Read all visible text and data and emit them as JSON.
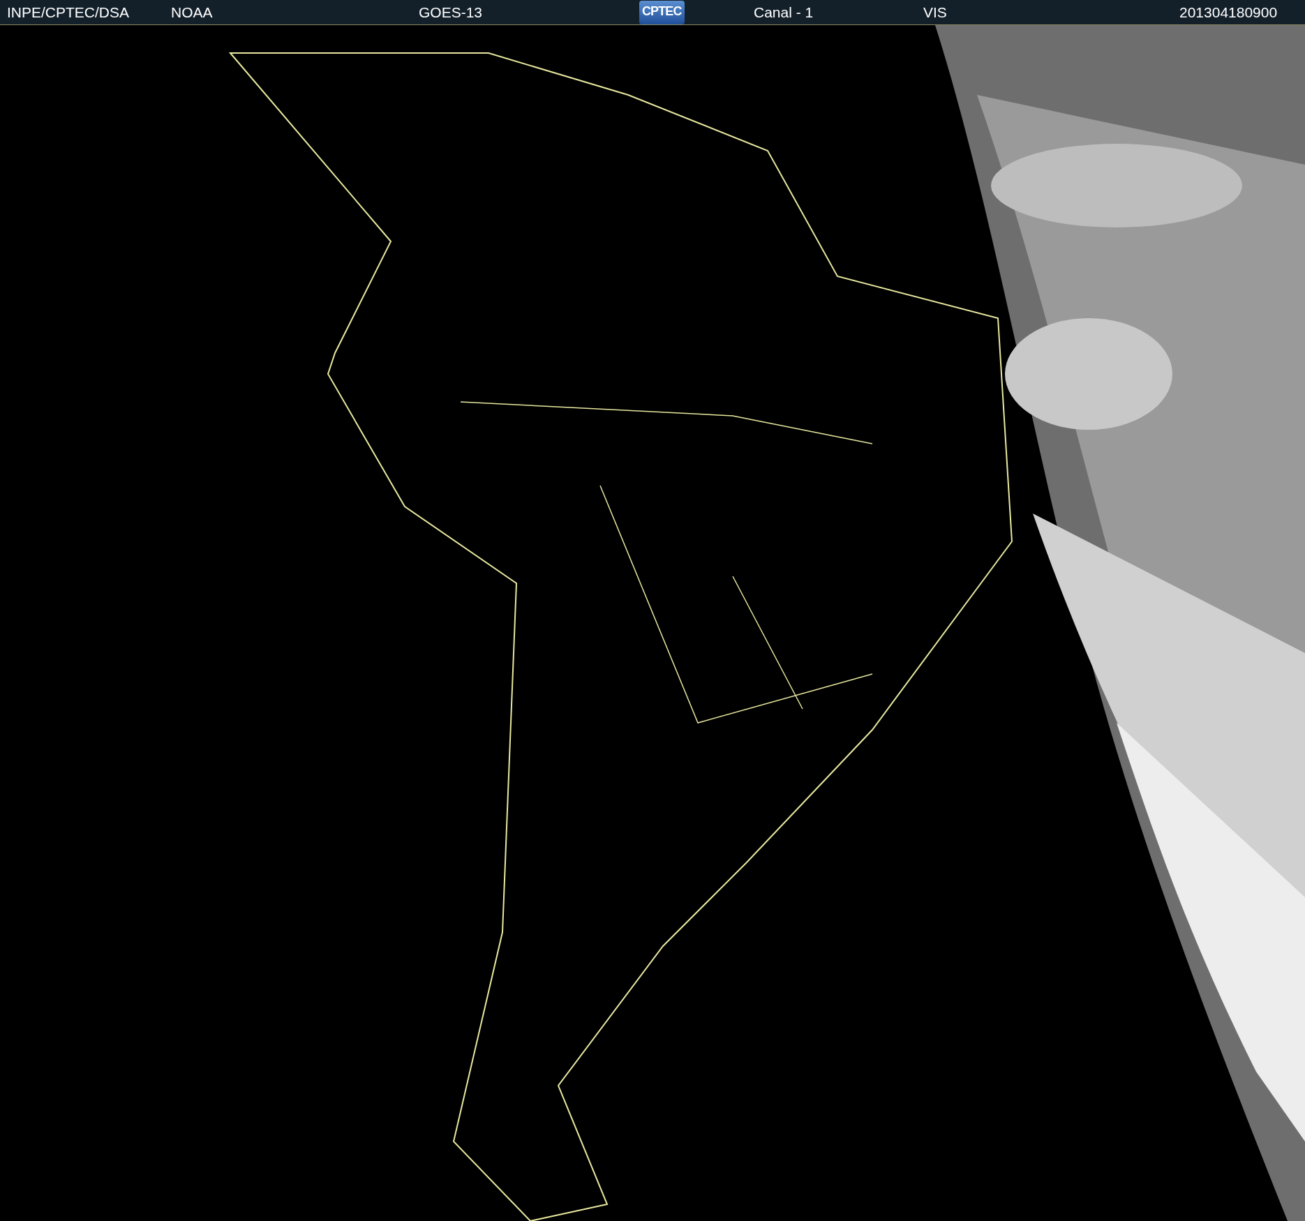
{
  "header": {
    "items": [
      {
        "kind": "text",
        "text": "INPE/CPTEC/DSA"
      },
      {
        "kind": "text",
        "text": "NOAA"
      },
      {
        "kind": "text",
        "text": "GOES-13"
      },
      {
        "kind": "logo",
        "text": "CPTEC"
      },
      {
        "kind": "text",
        "text": "Canal - 1"
      },
      {
        "kind": "text",
        "text": "VIS"
      },
      {
        "kind": "text",
        "text": "201304180900"
      }
    ]
  }
}
